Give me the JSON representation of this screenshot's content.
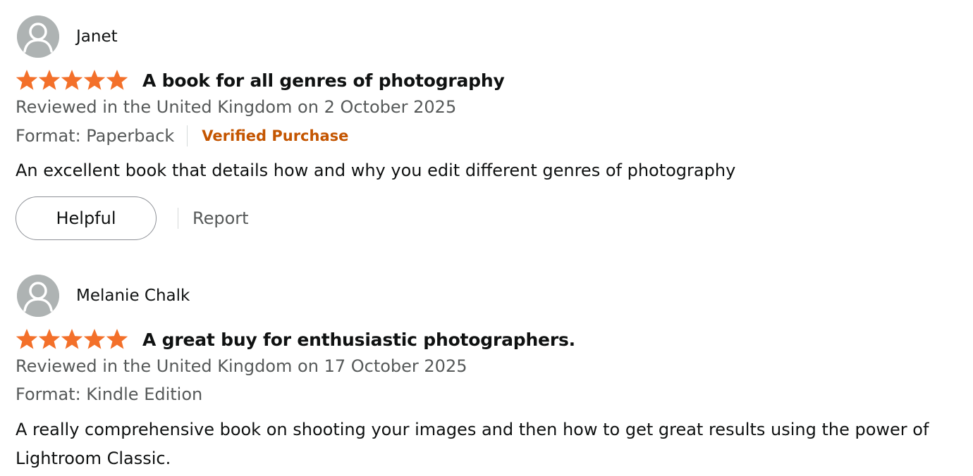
{
  "reviews": [
    {
      "reviewer_name": "Janet",
      "rating": 5,
      "title": "A book for all genres of photography",
      "date_line": "Reviewed in the United Kingdom on 2 October 2025",
      "format": "Format: Paperback",
      "verified_label": "Verified Purchase",
      "body": "An excellent book that details how and why you edit different genres of photography",
      "helpful_label": "Helpful",
      "report_label": "Report"
    },
    {
      "reviewer_name": "Melanie Chalk",
      "rating": 5,
      "title": "A great buy for enthusiastic photographers.",
      "date_line": "Reviewed in the United Kingdom on 17 October 2025",
      "format": "Format: Kindle Edition",
      "body": "A really comprehensive book on shooting your images and then how to get great results using the power of Lightroom Classic."
    }
  ],
  "colors": {
    "star": "#f3702a",
    "verified": "#c45500",
    "meta_text": "#565959",
    "avatar_bg": "#aeb3b3"
  },
  "icons": {
    "avatar": "user-silhouette-icon",
    "star": "star-filled-icon"
  }
}
